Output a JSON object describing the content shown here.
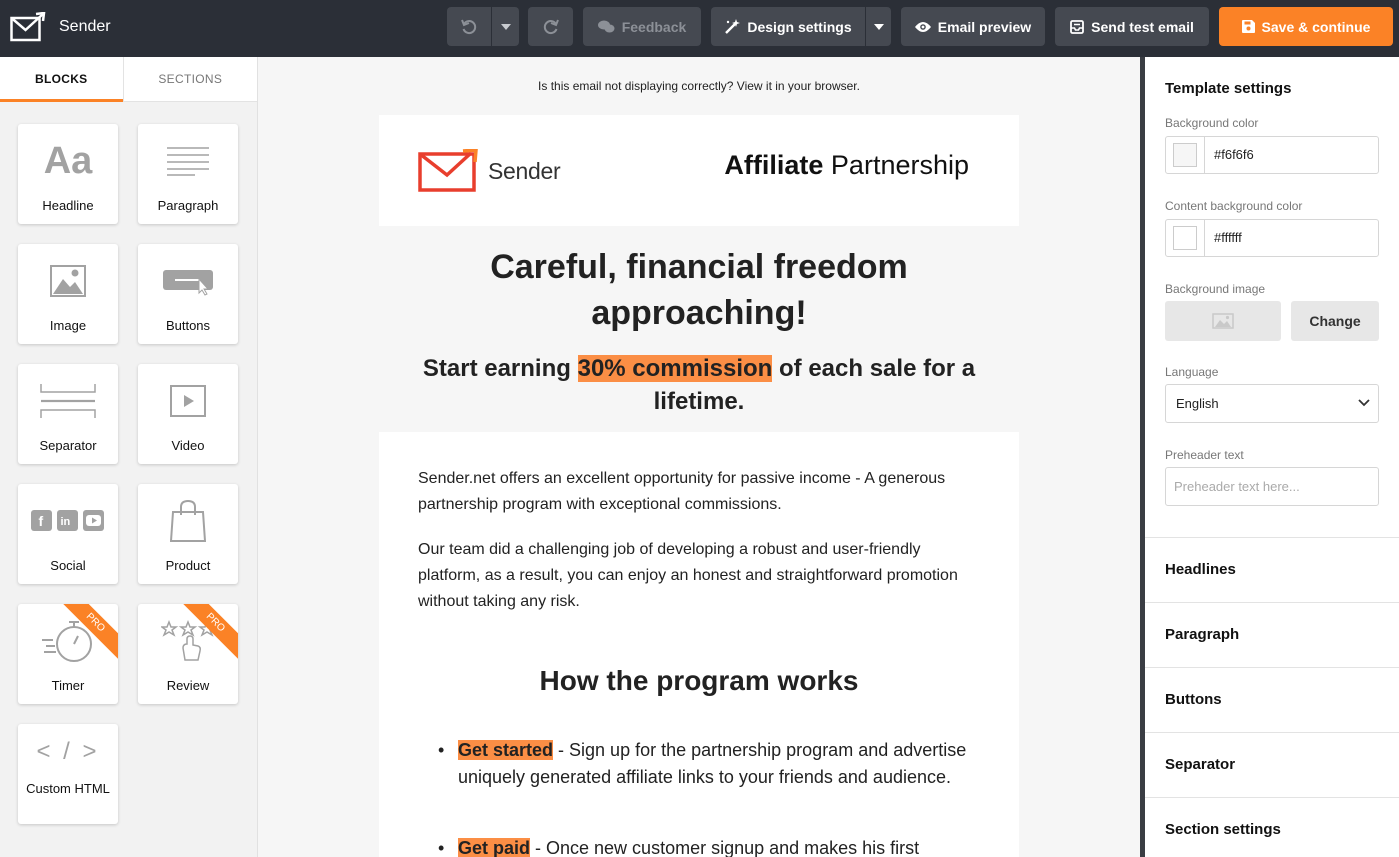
{
  "topbar": {
    "app_name": "Sender",
    "feedback": "Feedback",
    "design_settings": "Design settings",
    "email_preview": "Email preview",
    "send_test_email": "Send test email",
    "save_continue": "Save & continue",
    "accent_color": "#fb8226",
    "bar_color": "#2b2f37"
  },
  "left_panel": {
    "tabs": [
      "BLOCKS",
      "SECTIONS"
    ],
    "blocks": [
      {
        "label": "Headline",
        "icon": "headline-icon"
      },
      {
        "label": "Paragraph",
        "icon": "paragraph-icon"
      },
      {
        "label": "Image",
        "icon": "image-icon"
      },
      {
        "label": "Buttons",
        "icon": "button-icon"
      },
      {
        "label": "Separator",
        "icon": "separator-icon"
      },
      {
        "label": "Video",
        "icon": "video-icon"
      },
      {
        "label": "Social",
        "icon": "social-icon"
      },
      {
        "label": "Product",
        "icon": "shopping-bag-icon"
      },
      {
        "label": "Timer",
        "icon": "stopwatch-icon",
        "badge": "PRO"
      },
      {
        "label": "Review",
        "icon": "stars-icon",
        "badge": "PRO"
      },
      {
        "label": "Custom HTML",
        "icon": "code-icon"
      }
    ]
  },
  "email": {
    "preheader_link": "Is this email not displaying correctly? View it in your browser.",
    "logo_text": "Sender",
    "header_title_bold": "Affiliate",
    "header_title_rest": " Partnership",
    "hero_title": "Careful, financial freedom approaching!",
    "hero_sub_before": "Start earning ",
    "hero_sub_highlight": "30% commission",
    "hero_sub_after": " of each sale for a lifetime.",
    "paragraph_1": "Sender.net offers an excellent opportunity for passive income - A generous partnership program with exceptional commissions.",
    "paragraph_2": "Our team did a challenging job of developing a robust and user-friendly platform, as a result, you can enjoy an honest and straightforward promotion without taking any risk.",
    "section_title": "How the program works",
    "bullets": [
      {
        "highlight": "Get started",
        "text": " - Sign up for the partnership program and advertise uniquely generated affiliate links to your friends and audience."
      },
      {
        "highlight": "Get paid",
        "text": " - Once new customer signup and makes his first"
      }
    ],
    "highlight_color": "#fb8e45"
  },
  "right_panel": {
    "title": "Template settings",
    "bg_color_label": "Background color",
    "bg_color_value": "#f6f6f6",
    "content_bg_label": "Content background color",
    "content_bg_value": "#ffffff",
    "bg_image_label": "Background image",
    "change_button": "Change",
    "language_label": "Language",
    "language_value": "English",
    "preheader_label": "Preheader text",
    "preheader_placeholder": "Preheader text here...",
    "sections": [
      "Headlines",
      "Paragraph",
      "Buttons",
      "Separator",
      "Section settings"
    ]
  }
}
